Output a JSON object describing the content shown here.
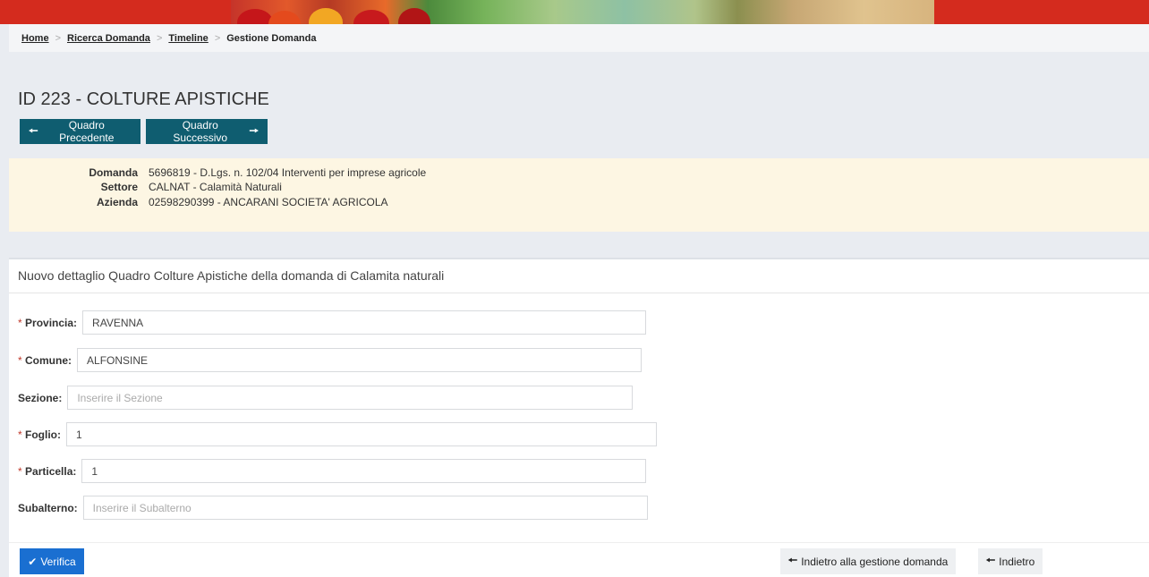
{
  "breadcrumb": {
    "home": "Home",
    "ricerca": "Ricerca Domanda",
    "timeline": "Timeline",
    "current": "Gestione Domanda",
    "separator": ">"
  },
  "page": {
    "title": "ID 223 - COLTURE APISTICHE"
  },
  "nav": {
    "prev_label": "Quadro Precedente",
    "next_label": "Quadro Successivo"
  },
  "info": {
    "domanda_label": "Domanda",
    "domanda_value": "5696819 - D.Lgs. n. 102/04 Interventi per imprese agricole",
    "settore_label": "Settore",
    "settore_value": "CALNAT - Calamità Naturali",
    "azienda_label": "Azienda",
    "azienda_value": "02598290399 - ANCARANI SOCIETA' AGRICOLA"
  },
  "form": {
    "header": "Nuovo dettaglio Quadro Colture Apistiche della domanda di Calamita naturali",
    "required_mark": "*",
    "fields": [
      {
        "label": "Provincia:",
        "value": "RAVENNA",
        "placeholder": "",
        "required": true
      },
      {
        "label": "Comune:",
        "value": "ALFONSINE",
        "placeholder": "",
        "required": true
      },
      {
        "label": "Sezione:",
        "value": "",
        "placeholder": "Inserire il Sezione",
        "required": false
      },
      {
        "label": "Foglio:",
        "value": "1",
        "placeholder": "",
        "required": true
      },
      {
        "label": "Particella:",
        "value": "1",
        "placeholder": "",
        "required": true
      },
      {
        "label": "Subalterno:",
        "value": "",
        "placeholder": "Inserire il Subalterno",
        "required": false
      }
    ]
  },
  "actions": {
    "verifica_label": "Verifica",
    "back_mgmt_label": "Indietro alla gestione domanda",
    "back_label": "Indietro"
  },
  "colors": {
    "banner_red": "#d42b1e",
    "nav_teal": "#0f5d70",
    "primary_blue": "#1a6fd1",
    "info_bg": "#fdf6e3"
  },
  "icons": {
    "prev": "arrow-left-icon",
    "next": "arrow-right-icon",
    "verifica": "check-icon",
    "back": "arrow-left-icon"
  }
}
